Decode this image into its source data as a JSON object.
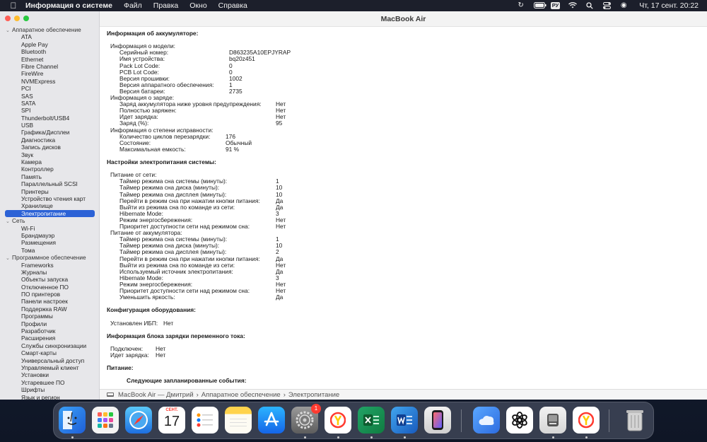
{
  "menubar": {
    "app_name": "Информация о системе",
    "menus": [
      "Файл",
      "Правка",
      "Окно",
      "Справка"
    ],
    "keyboard_layout": "РУ",
    "clock": "Чт, 17 сент.  20:22"
  },
  "window": {
    "title": "MacBook Air"
  },
  "sidebar": {
    "rows": [
      {
        "label": "Аппаратное обеспечение",
        "type": "cat"
      },
      {
        "label": "ATA",
        "type": "leaf"
      },
      {
        "label": "Apple Pay",
        "type": "leaf"
      },
      {
        "label": "Bluetooth",
        "type": "leaf"
      },
      {
        "label": "Ethernet",
        "type": "leaf"
      },
      {
        "label": "Fibre Channel",
        "type": "leaf"
      },
      {
        "label": "FireWire",
        "type": "leaf"
      },
      {
        "label": "NVMExpress",
        "type": "leaf"
      },
      {
        "label": "PCI",
        "type": "leaf"
      },
      {
        "label": "SAS",
        "type": "leaf"
      },
      {
        "label": "SATA",
        "type": "leaf"
      },
      {
        "label": "SPI",
        "type": "leaf"
      },
      {
        "label": "Thunderbolt/USB4",
        "type": "leaf"
      },
      {
        "label": "USB",
        "type": "leaf"
      },
      {
        "label": "Графика/Дисплеи",
        "type": "leaf"
      },
      {
        "label": "Диагностика",
        "type": "leaf"
      },
      {
        "label": "Запись дисков",
        "type": "leaf"
      },
      {
        "label": "Звук",
        "type": "leaf"
      },
      {
        "label": "Камера",
        "type": "leaf"
      },
      {
        "label": "Контроллер",
        "type": "leaf"
      },
      {
        "label": "Память",
        "type": "leaf"
      },
      {
        "label": "Параллельный SCSI",
        "type": "leaf"
      },
      {
        "label": "Принтеры",
        "type": "leaf"
      },
      {
        "label": "Устройство чтения карт",
        "type": "leaf"
      },
      {
        "label": "Хранилище",
        "type": "leaf"
      },
      {
        "label": "Электропитание",
        "type": "leaf",
        "selected": true
      },
      {
        "label": "Сеть",
        "type": "cat"
      },
      {
        "label": "Wi-Fi",
        "type": "leaf"
      },
      {
        "label": "Брандмауэр",
        "type": "leaf"
      },
      {
        "label": "Размещения",
        "type": "leaf"
      },
      {
        "label": "Тома",
        "type": "leaf"
      },
      {
        "label": "Программное обеспечение",
        "type": "cat"
      },
      {
        "label": "Frameworks",
        "type": "leaf"
      },
      {
        "label": "Журналы",
        "type": "leaf"
      },
      {
        "label": "Объекты запуска",
        "type": "leaf"
      },
      {
        "label": "Отключенное ПО",
        "type": "leaf"
      },
      {
        "label": "ПО принтеров",
        "type": "leaf"
      },
      {
        "label": "Панели настроек",
        "type": "leaf"
      },
      {
        "label": "Поддержка RAW",
        "type": "leaf"
      },
      {
        "label": "Программы",
        "type": "leaf"
      },
      {
        "label": "Профили",
        "type": "leaf"
      },
      {
        "label": "Разработчик",
        "type": "leaf"
      },
      {
        "label": "Расширения",
        "type": "leaf"
      },
      {
        "label": "Службы синхронизации",
        "type": "leaf"
      },
      {
        "label": "Смарт-карты",
        "type": "leaf"
      },
      {
        "label": "Универсальный доступ",
        "type": "leaf"
      },
      {
        "label": "Управляемый клиент",
        "type": "leaf"
      },
      {
        "label": "Установки",
        "type": "leaf"
      },
      {
        "label": "Устаревшее ПО",
        "type": "leaf"
      },
      {
        "label": "Шрифты",
        "type": "leaf"
      },
      {
        "label": "Язык и регион",
        "type": "leaf"
      }
    ]
  },
  "content": {
    "rows": [
      {
        "t": "h",
        "label": "Информация об аккумуляторе:"
      },
      {
        "t": "sp"
      },
      {
        "t": "l1",
        "label": "Информация о модели:"
      },
      {
        "t": "l2",
        "label": "Серийный номер:",
        "value": "D863235A10EPJYRAP",
        "col": 155
      },
      {
        "t": "l2",
        "label": "Имя устройства:",
        "value": "bq20z451",
        "col": 155
      },
      {
        "t": "l2",
        "label": "Pack Lot Code:",
        "value": "0",
        "col": 155
      },
      {
        "t": "l2",
        "label": "PCB Lot Code:",
        "value": "0",
        "col": 155
      },
      {
        "t": "l2",
        "label": "Версия прошивки:",
        "value": "1002",
        "col": 155
      },
      {
        "t": "l2",
        "label": "Версия аппаратного обеспечения:",
        "value": "1",
        "col": 155
      },
      {
        "t": "l2",
        "label": "Версия батареи:",
        "value": "2735",
        "col": 155
      },
      {
        "t": "l1",
        "label": "Информация о заряде:"
      },
      {
        "t": "l2",
        "label": "Заряд аккумулятора ниже уровня предупреждения:",
        "value": "Нет",
        "col": 221
      },
      {
        "t": "l2",
        "label": "Полностью заряжен:",
        "value": "Нет",
        "col": 221
      },
      {
        "t": "l2",
        "label": "Идет зарядка:",
        "value": "Нет",
        "col": 221
      },
      {
        "t": "l2",
        "label": "Заряд (%):",
        "value": "95",
        "col": 221
      },
      {
        "t": "l1",
        "label": "Информация о степени исправности:"
      },
      {
        "t": "l2",
        "label": "Количество циклов перезарядки:",
        "value": "176",
        "col": 150
      },
      {
        "t": "l2",
        "label": "Состояние:",
        "value": "Обычный",
        "col": 150
      },
      {
        "t": "l2",
        "label": "Максимальная емкость:",
        "value": "91 %",
        "col": 150
      },
      {
        "t": "sp"
      },
      {
        "t": "h",
        "label": "Настройки электропитания системы:"
      },
      {
        "t": "sp"
      },
      {
        "t": "l1",
        "label": "Питание от сети:"
      },
      {
        "t": "l2",
        "label": "Таймер режима сна системы (минуты):",
        "value": "1",
        "col": 221
      },
      {
        "t": "l2",
        "label": "Таймер режима сна диска (минуты):",
        "value": "10",
        "col": 221
      },
      {
        "t": "l2",
        "label": "Таймер режима сна дисплея (минуты):",
        "value": "10",
        "col": 221
      },
      {
        "t": "l2",
        "label": "Перейти в режим сна при нажатии кнопки питания:",
        "value": "Да",
        "col": 221
      },
      {
        "t": "l2",
        "label": "Выйти из режима сна по команде из сети:",
        "value": "Да",
        "col": 221
      },
      {
        "t": "l2",
        "label": "Hibernate Mode:",
        "value": "3",
        "col": 221
      },
      {
        "t": "l2",
        "label": "Режим энергосбережения:",
        "value": "Нет",
        "col": 221
      },
      {
        "t": "l2",
        "label": "Приоритет доступности сети над режимом сна:",
        "value": "Нет",
        "col": 221
      },
      {
        "t": "l1",
        "label": "Питание от аккумулятора:"
      },
      {
        "t": "l2",
        "label": "Таймер режима сна системы (минуты):",
        "value": "1",
        "col": 221
      },
      {
        "t": "l2",
        "label": "Таймер режима сна диска (минуты):",
        "value": "10",
        "col": 221
      },
      {
        "t": "l2",
        "label": "Таймер режима сна дисплея (минуты):",
        "value": "2",
        "col": 221
      },
      {
        "t": "l2",
        "label": "Перейти в режим сна при нажатии кнопки питания:",
        "value": "Да",
        "col": 221
      },
      {
        "t": "l2",
        "label": "Выйти из режима сна по команде из сети:",
        "value": "Нет",
        "col": 221
      },
      {
        "t": "l2",
        "label": "Используемый источник электропитания:",
        "value": "Да",
        "col": 221
      },
      {
        "t": "l2",
        "label": "Hibernate Mode:",
        "value": "3",
        "col": 221
      },
      {
        "t": "l2",
        "label": "Режим энергосбережения:",
        "value": "Нет",
        "col": 221
      },
      {
        "t": "l2",
        "label": "Приоритет доступности сети над режимом сна:",
        "value": "Нет",
        "col": 221
      },
      {
        "t": "l2",
        "label": "Уменьшить яркость:",
        "value": "Да",
        "col": 221
      },
      {
        "t": "sp"
      },
      {
        "t": "h",
        "label": "Конфигурация оборудования:"
      },
      {
        "t": "sp"
      },
      {
        "t": "l1",
        "label": "Установлен ИБП:",
        "value": "Нет",
        "col": 75
      },
      {
        "t": "sp"
      },
      {
        "t": "h",
        "label": "Информация блока зарядки переменного тока:"
      },
      {
        "t": "sp"
      },
      {
        "t": "l1",
        "label": "Подключен:",
        "value": "Нет",
        "col": 64
      },
      {
        "t": "l1",
        "label": "Идет зарядка:",
        "value": "Нет",
        "col": 64
      },
      {
        "t": "sp"
      },
      {
        "t": "h",
        "label": "Питание:"
      },
      {
        "t": "sp"
      },
      {
        "t": "l3",
        "label": "Следующие запланированные события:"
      }
    ]
  },
  "pathbar": {
    "parts": [
      "MacBook Air — Дмитрий",
      "Аппаратное обеспечение",
      "Электропитание"
    ],
    "separator": "›"
  },
  "dock": {
    "calendar_month": "СЕНТ.",
    "calendar_day": "17",
    "settings_badge": "1"
  }
}
